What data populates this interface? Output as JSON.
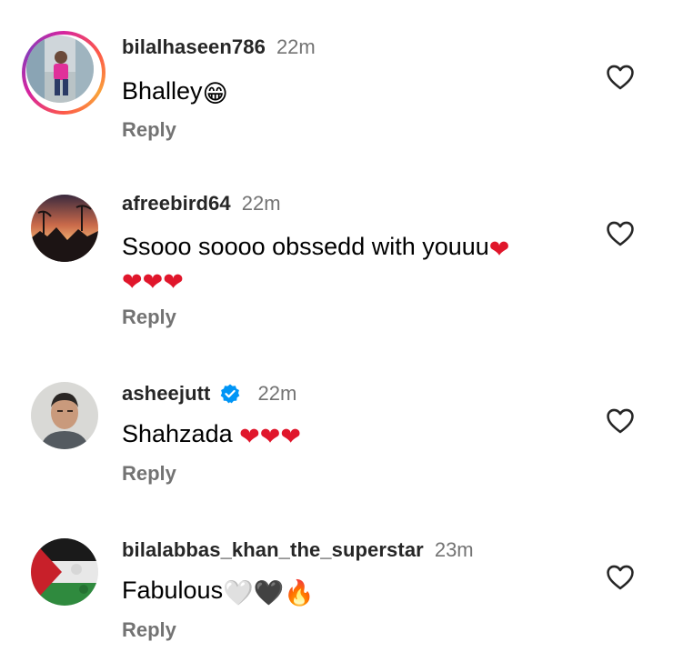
{
  "comments": [
    {
      "username": "bilalhaseen786",
      "time": "22m",
      "text": "Bhalley",
      "emojis": [
        "😁"
      ],
      "reply_label": "Reply",
      "has_story_ring": true,
      "verified": false
    },
    {
      "username": "afreebird64",
      "time": "22m",
      "text": "Ssooo soooo obssedd with youuu",
      "emojis": [
        "❤",
        "❤",
        "❤",
        "❤"
      ],
      "reply_label": "Reply",
      "has_story_ring": false,
      "verified": false
    },
    {
      "username": "asheejutt",
      "time": "22m",
      "text": "Shahzada",
      "emojis": [
        "❤",
        "❤",
        "❤"
      ],
      "reply_label": "Reply",
      "has_story_ring": false,
      "verified": true
    },
    {
      "username": "bilalabbas_khan_the_superstar",
      "time": "23m",
      "text": "Fabulous",
      "emojis": [
        "🤍",
        "🖤",
        "🔥"
      ],
      "reply_label": "Reply",
      "has_story_ring": false,
      "verified": false
    }
  ],
  "colors": {
    "username": "#262626",
    "meta": "#737373",
    "heart_emoji": "#e0162b",
    "verified_badge": "#0095f6"
  },
  "icons": {
    "like": "heart-outline-icon",
    "verified": "verified-badge-icon"
  }
}
